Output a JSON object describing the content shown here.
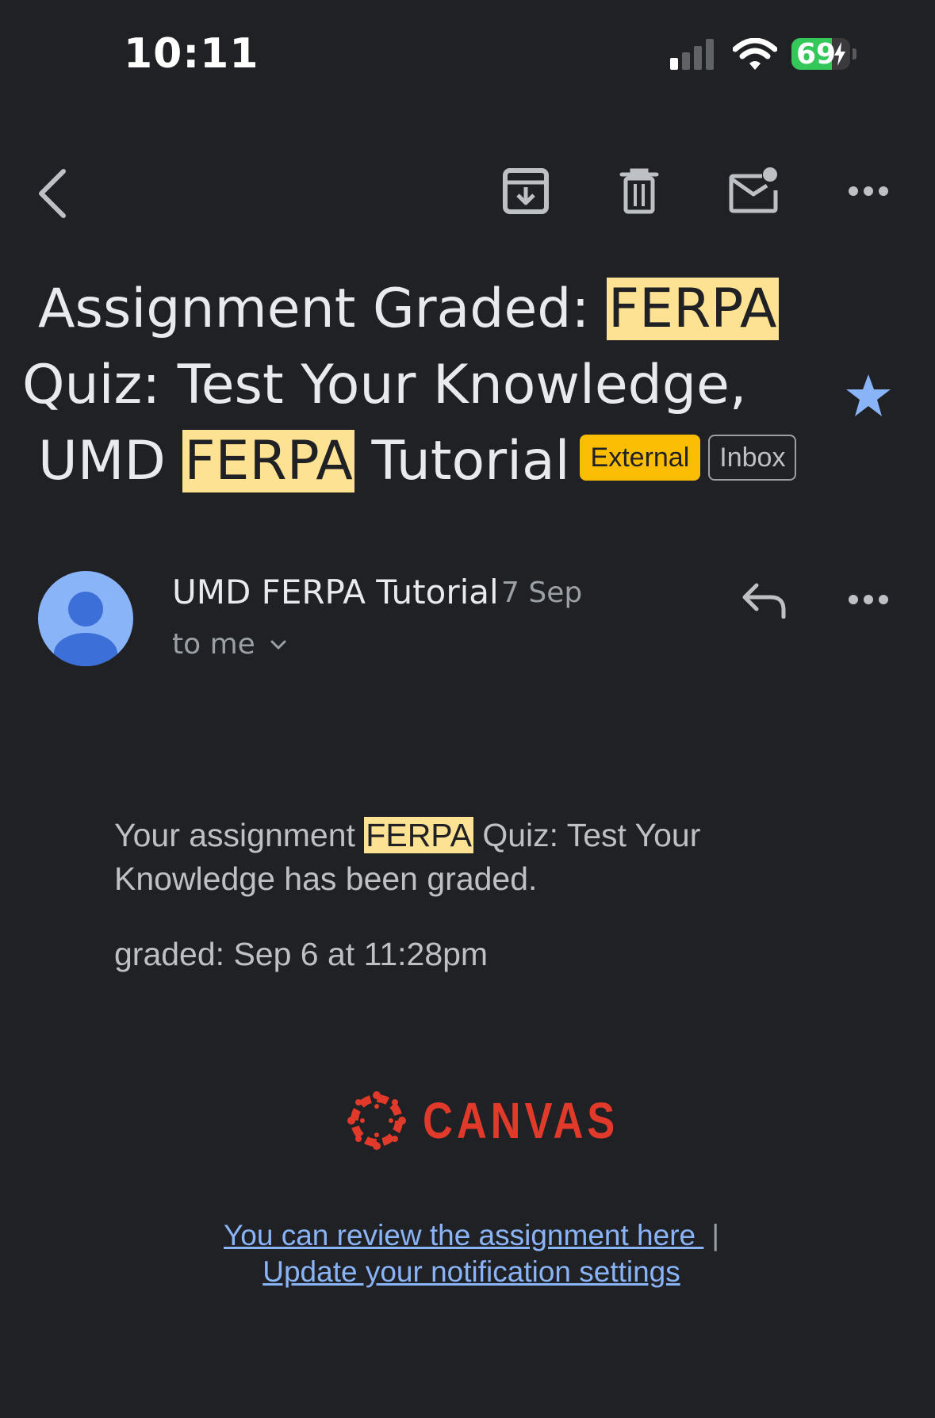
{
  "status_bar": {
    "time": "10:11",
    "battery_level": "69",
    "battery_fraction": 0.69,
    "signal_bars_active": 1,
    "signal_bars_total": 4
  },
  "toolbar": {
    "icons": [
      "back-icon",
      "archive-icon",
      "delete-icon",
      "mark-unread-icon",
      "more-icon"
    ]
  },
  "subject": {
    "part1": "Assignment Graded: ",
    "highlight1": "FERPA",
    "part2": " Quiz: Test Your Knowledge,",
    "part3": "UMD ",
    "highlight2": "FERPA",
    "part4": " Tutorial",
    "label_external": "External",
    "label_inbox": "Inbox",
    "starred": true
  },
  "sender": {
    "name": "UMD FERPA Tutorial",
    "date": "7 Sep",
    "recipient": "to me"
  },
  "body": {
    "line_prefix": "Your assignment ",
    "highlight": "FERPA",
    "line_suffix": " Quiz: Test Your Knowledge has been graded.",
    "graded": "graded: Sep 6 at 11:28pm",
    "logo_text": "CANVAS"
  },
  "footer": {
    "review_link": "You can review the assignment here ",
    "separator": "|",
    "settings_link": "Update your notification settings"
  },
  "colors": {
    "background": "#202124",
    "highlight": "#fde293",
    "external_label": "#fbbc04",
    "link": "#8ab4f8",
    "star": "#8ab4f8",
    "avatar": "#8ab4f8",
    "canvas_red": "#e13a2a",
    "battery_green": "#34c759"
  }
}
